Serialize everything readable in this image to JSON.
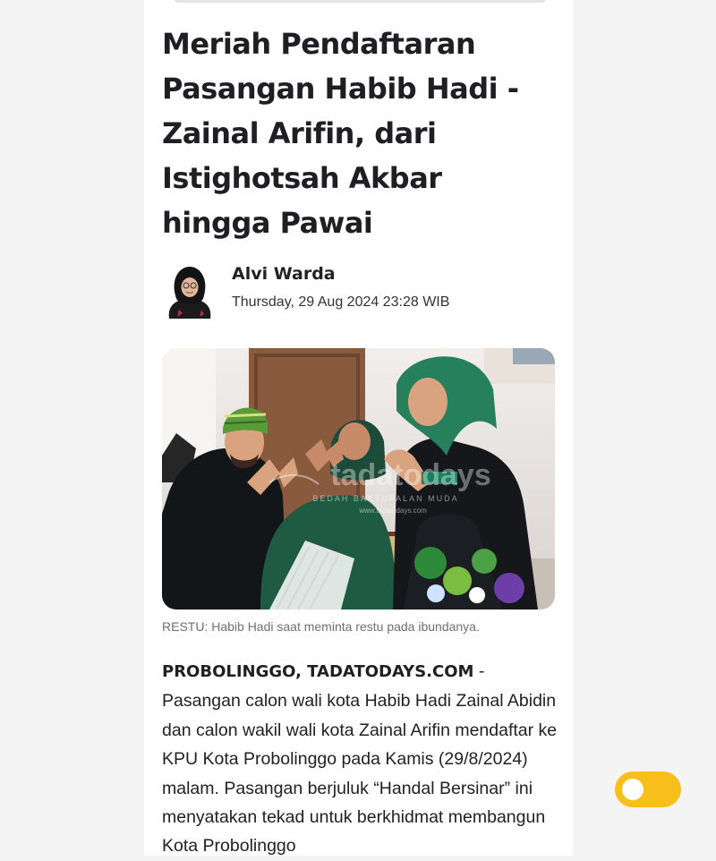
{
  "article": {
    "title": "Meriah Pendaftaran Pasangan Habib Hadi - Zainal Arifin, dari Istighotsah Akbar hingga Pawai",
    "author": {
      "name": "Alvi Warda",
      "published": "Thursday, 29 Aug 2024 23:28 WIB",
      "avatar_icon": "author-avatar"
    },
    "photo": {
      "caption": "RESTU: Habib Hadi saat meminta restu pada ibundanya.",
      "watermark": "tadatodays",
      "watermark_tagline": "BEDAH BAKTUPALAN MUDA",
      "watermark_url": "www.tadatodays.com"
    },
    "body": {
      "dateline": "PROBOLINGGO, TADATODAYS.COM",
      "separator": " - ",
      "text": "Pasangan calon wali kota Habib Hadi Zainal Abidin dan calon wakil wali kota Zainal Arifin mendaftar ke KPU Kota Probolinggo pada Kamis (29/8/2024) malam. Pasangan berjuluk “Handal Bersinar” ini menyatakan tekad untuk berkhidmat membangun Kota Probolinggo"
    }
  },
  "theme_toggle": {
    "icon": "toggle-switch",
    "state": "off",
    "track_color": "#f8bf1c",
    "knob_color": "#ffffff"
  },
  "colors": {
    "page_background": "#f4f4f4",
    "column_background": "#ffffff",
    "title": "#1f1f23",
    "caption": "#6f6f6f"
  }
}
